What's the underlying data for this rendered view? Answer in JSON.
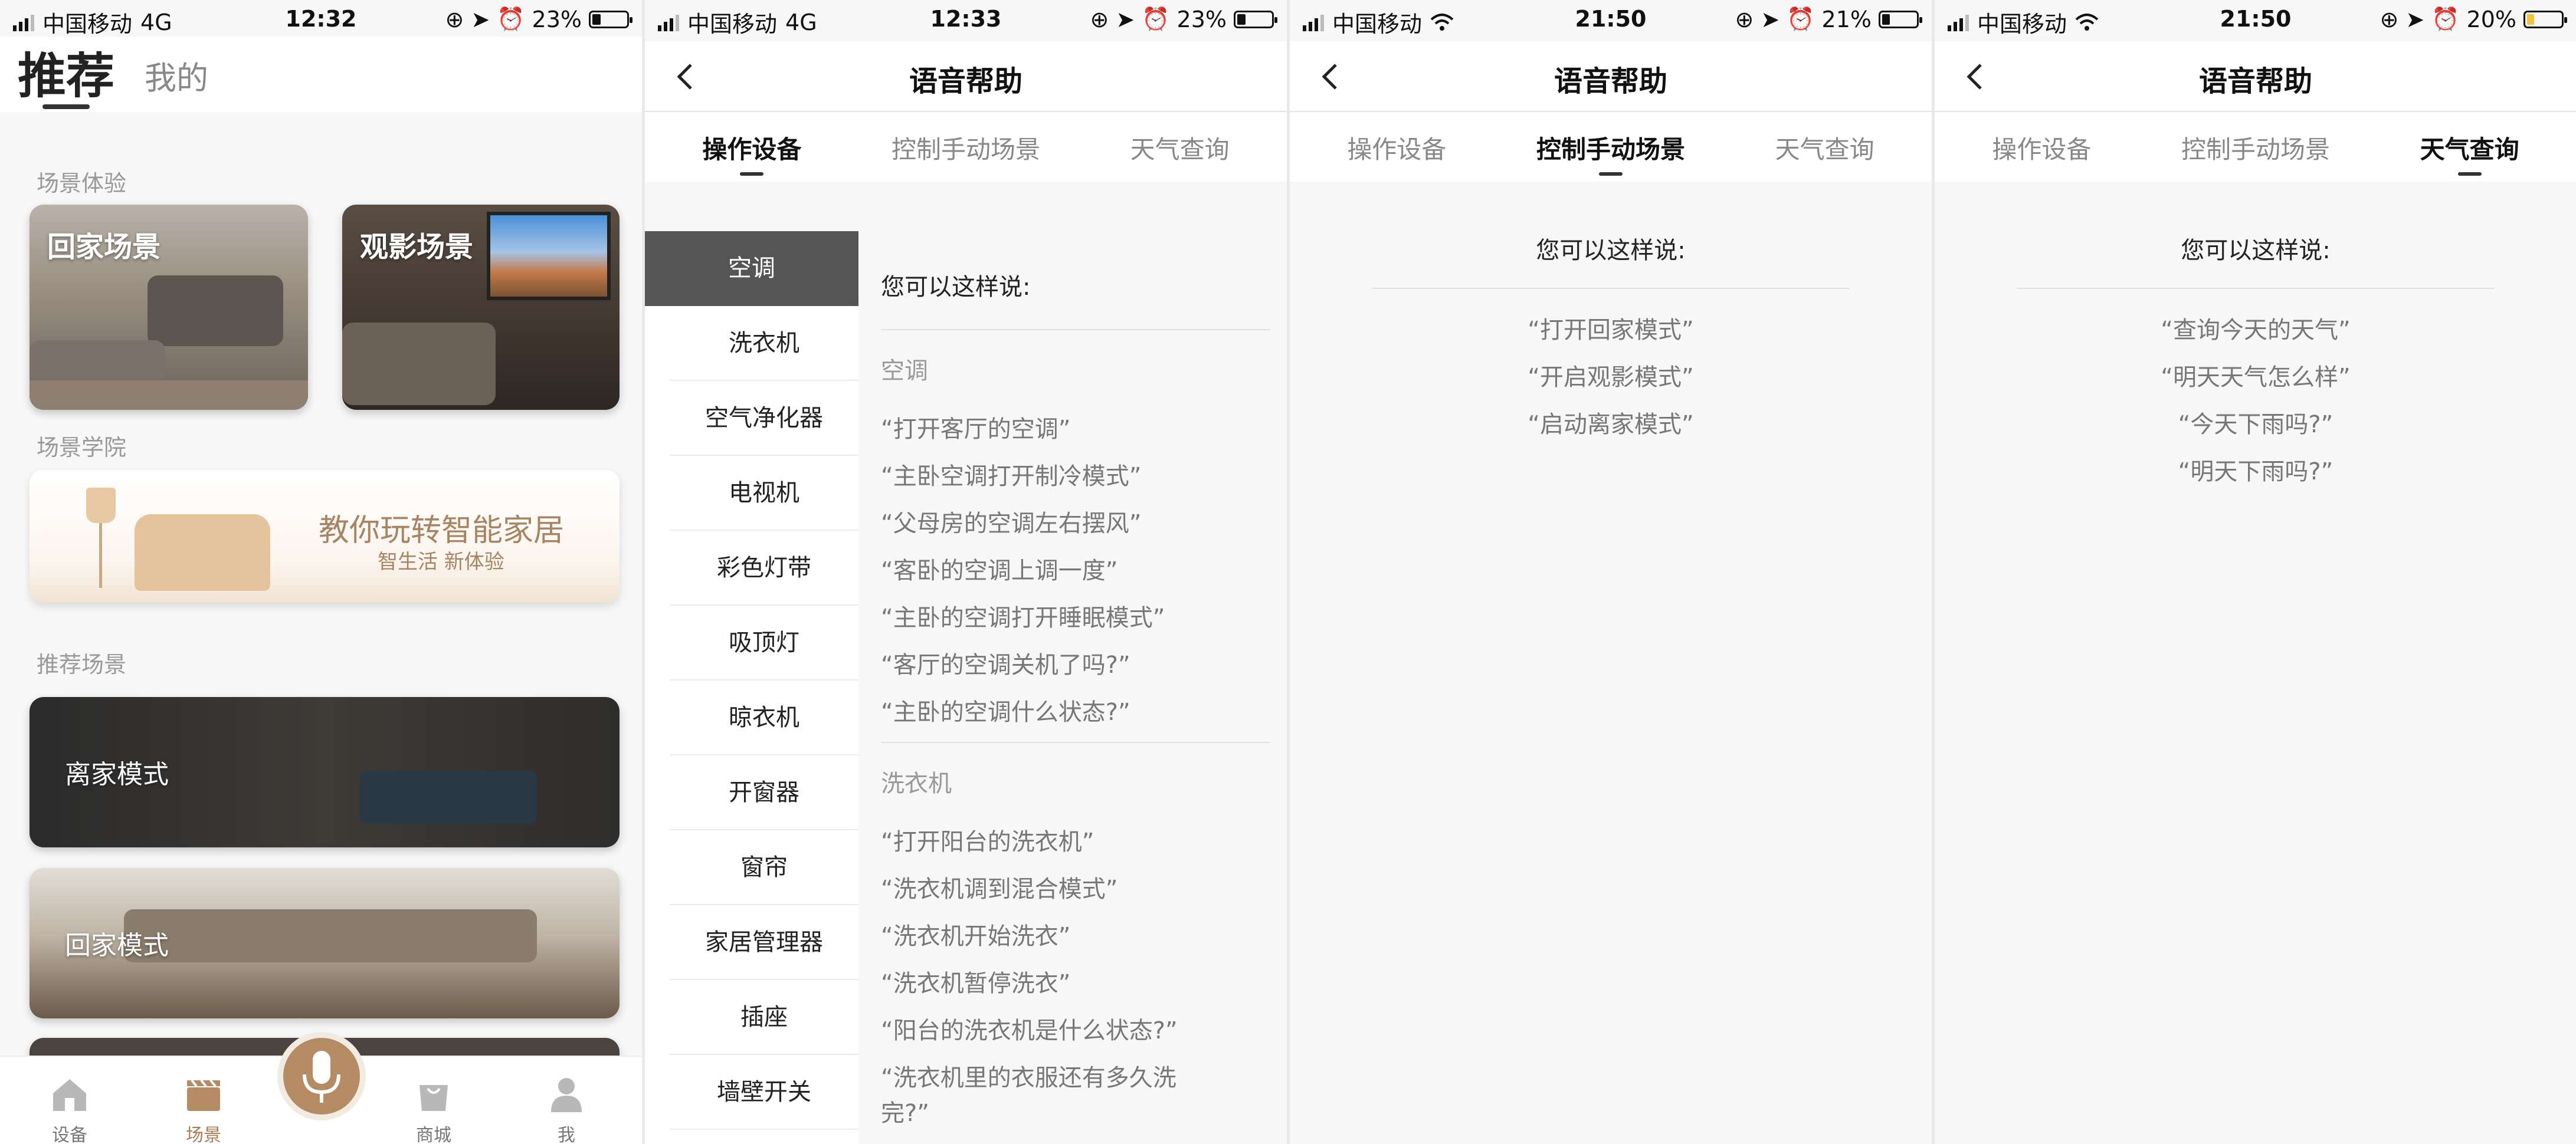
{
  "panel1": {
    "status": {
      "carrier": "中国移动",
      "network": "4G",
      "time": "12:32",
      "battery": "23%"
    },
    "top_tabs": {
      "recommend": "推荐",
      "mine": "我的"
    },
    "sections": {
      "experience": "场景体验",
      "academy": "场景学院",
      "recommended": "推荐场景"
    },
    "cards": {
      "home": "回家场景",
      "movie": "观影场景"
    },
    "academy_banner": {
      "title": "教你玩转智能家居",
      "subtitle": "智生活 新体验"
    },
    "scene_cards": {
      "away": "离家模式",
      "back": "回家模式"
    },
    "tabbar": {
      "devices": "设备",
      "scenes": "场景",
      "mall": "商城",
      "me": "我"
    },
    "accent_color": "#b48b63"
  },
  "panel2": {
    "status": {
      "carrier": "中国移动",
      "network": "4G",
      "time": "12:33",
      "battery": "23%"
    },
    "title": "语音帮助",
    "tabs": [
      "操作设备",
      "控制手动场景",
      "天气查询"
    ],
    "active_tab": 0,
    "side_items": [
      "空调",
      "洗衣机",
      "空气净化器",
      "电视机",
      "彩色灯带",
      "吸顶灯",
      "晾衣机",
      "开窗器",
      "窗帘",
      "家居管理器",
      "插座",
      "墙壁开关"
    ],
    "heading": "您可以这样说:",
    "categories": [
      {
        "name": "空调",
        "phrases": [
          "“打开客厅的空调”",
          "“主卧空调打开制冷模式”",
          "“父母房的空调左右摆风”",
          "“客卧的空调上调一度”",
          "“主卧的空调打开睡眠模式”",
          "“客厅的空调关机了吗?”",
          "“主卧的空调什么状态?”"
        ]
      },
      {
        "name": "洗衣机",
        "phrases": [
          "“打开阳台的洗衣机”",
          "“洗衣机调到混合模式”",
          "“洗衣机开始洗衣”",
          "“洗衣机暂停洗衣”",
          "“阳台的洗衣机是什么状态?”",
          "“洗衣机里的衣服还有多久洗",
          "完?”"
        ]
      }
    ]
  },
  "panel3": {
    "status": {
      "carrier": "中国移动",
      "time": "21:50",
      "battery": "21%"
    },
    "title": "语音帮助",
    "tabs": [
      "操作设备",
      "控制手动场景",
      "天气查询"
    ],
    "active_tab": 1,
    "heading": "您可以这样说:",
    "phrases": [
      "“打开回家模式”",
      "“开启观影模式”",
      "“启动离家模式”"
    ]
  },
  "panel4": {
    "status": {
      "carrier": "中国移动",
      "time": "21:50",
      "battery": "20%"
    },
    "title": "语音帮助",
    "tabs": [
      "操作设备",
      "控制手动场景",
      "天气查询"
    ],
    "active_tab": 2,
    "heading": "您可以这样说:",
    "phrases": [
      "“查询今天的天气”",
      "“明天天气怎么样”",
      "“今天下雨吗?”",
      "“明天下雨吗?”"
    ]
  }
}
